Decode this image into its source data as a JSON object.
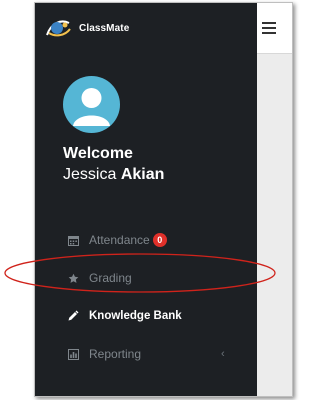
{
  "brand": {
    "name": "ClassMate",
    "logo_icon": "classmate-logo-icon"
  },
  "user": {
    "greeting": "Welcome",
    "first_name": "Jessica",
    "last_name": "Akian",
    "avatar_icon": "user-avatar-icon"
  },
  "header": {
    "menu_icon": "hamburger-menu-icon"
  },
  "menu": {
    "attendance": {
      "label": "Attendance",
      "badge": "0",
      "icon": "calendar-icon"
    },
    "grading": {
      "label": "Grading",
      "icon": "star-icon"
    },
    "knowledge_bank": {
      "label": "Knowledge Bank",
      "icon": "pencil-icon"
    },
    "reporting": {
      "label": "Reporting",
      "icon": "bar-chart-icon",
      "chevron": "‹"
    }
  },
  "colors": {
    "sidebar_bg": "#1d2024",
    "menu_text": "#7f868c",
    "active_text": "#ffffff",
    "badge": "#e0302a",
    "avatar_bg": "#55b6d5",
    "annotation": "#d0231b"
  }
}
